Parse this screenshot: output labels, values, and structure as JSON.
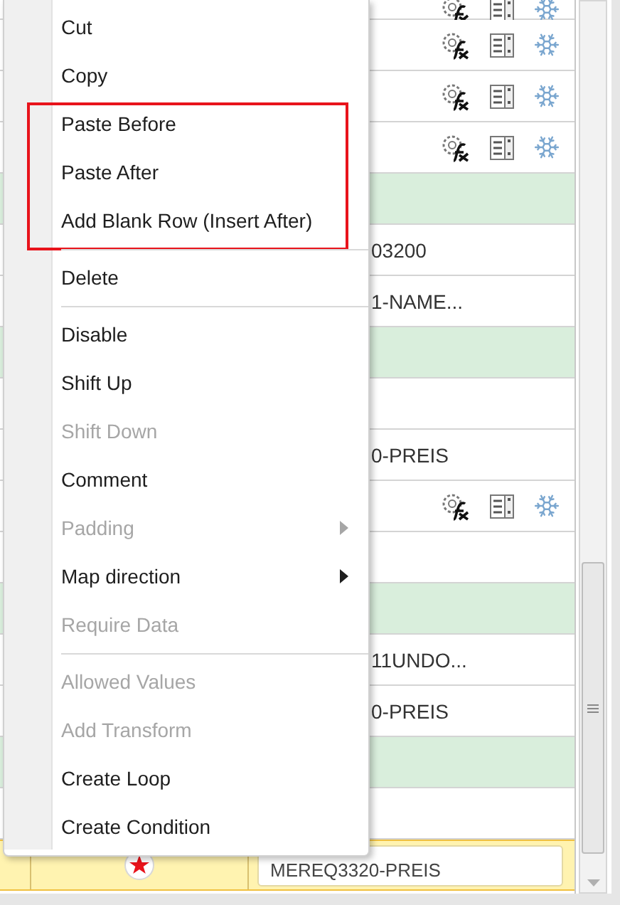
{
  "grid": {
    "rows": [
      {
        "kind": "icons"
      },
      {
        "kind": "icons"
      },
      {
        "kind": "icons"
      },
      {
        "kind": "icons"
      },
      {
        "kind": "band"
      },
      {
        "kind": "text",
        "text": "03200"
      },
      {
        "kind": "text",
        "text": "1-NAME..."
      },
      {
        "kind": "band"
      },
      {
        "kind": "empty"
      },
      {
        "kind": "text",
        "text": "0-PREIS"
      },
      {
        "kind": "icons"
      },
      {
        "kind": "empty"
      },
      {
        "kind": "band"
      },
      {
        "kind": "text",
        "text": "11UNDO..."
      },
      {
        "kind": "text",
        "text": "0-PREIS"
      },
      {
        "kind": "band"
      },
      {
        "kind": "empty"
      },
      {
        "kind": "current",
        "text": "MEREQ3320-PREIS"
      }
    ]
  },
  "menu": {
    "items": [
      {
        "kind": "item",
        "label": "Cut",
        "disabled": false,
        "highlighted": false
      },
      {
        "kind": "item",
        "label": "Copy",
        "disabled": false,
        "highlighted": false
      },
      {
        "kind": "item",
        "label": "Paste Before",
        "disabled": false,
        "highlighted": true
      },
      {
        "kind": "item",
        "label": "Paste After",
        "disabled": false,
        "highlighted": true
      },
      {
        "kind": "item",
        "label": "Add Blank Row (Insert After)",
        "disabled": false,
        "highlighted": true
      },
      {
        "kind": "separator"
      },
      {
        "kind": "item",
        "label": "Delete",
        "disabled": false,
        "highlighted": false
      },
      {
        "kind": "separator"
      },
      {
        "kind": "item",
        "label": "Disable",
        "disabled": false,
        "highlighted": false
      },
      {
        "kind": "item",
        "label": "Shift Up",
        "disabled": false,
        "highlighted": false
      },
      {
        "kind": "item",
        "label": "Shift Down",
        "disabled": true,
        "highlighted": false
      },
      {
        "kind": "item",
        "label": "Comment",
        "disabled": false,
        "highlighted": false
      },
      {
        "kind": "submenu",
        "label": "Padding",
        "disabled": true,
        "highlighted": false
      },
      {
        "kind": "submenu",
        "label": "Map direction",
        "disabled": false,
        "highlighted": false
      },
      {
        "kind": "item",
        "label": "Require Data",
        "disabled": true,
        "highlighted": false
      },
      {
        "kind": "separator"
      },
      {
        "kind": "item",
        "label": "Allowed Values",
        "disabled": true,
        "highlighted": false
      },
      {
        "kind": "item",
        "label": "Add Transform",
        "disabled": true,
        "highlighted": false
      },
      {
        "kind": "item",
        "label": "Create Loop",
        "disabled": false,
        "highlighted": false
      },
      {
        "kind": "item",
        "label": "Create Condition",
        "disabled": false,
        "highlighted": false
      }
    ]
  }
}
